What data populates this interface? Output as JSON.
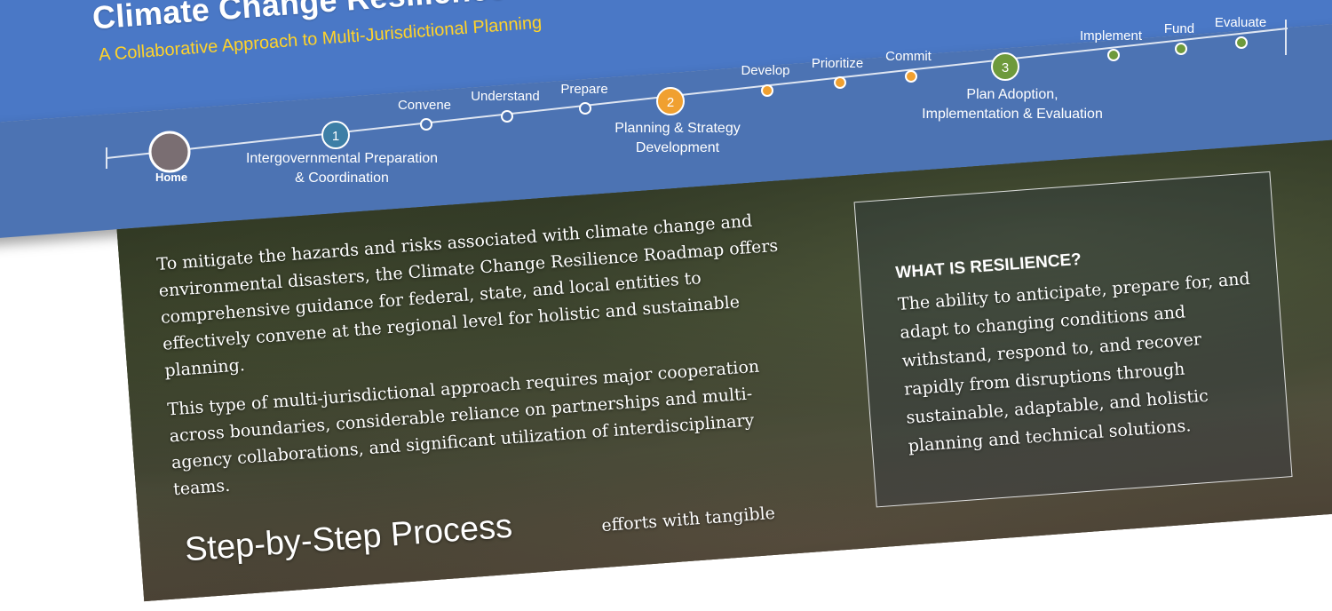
{
  "header": {
    "title": "Climate Change Resilience Roadmap",
    "subtitle": "A Collaborative Approach to Multi-Jurisdictional Planning"
  },
  "nav": {
    "home": "Home",
    "phases": [
      {
        "number": "1",
        "line1": "Intergovernmental Preparation",
        "line2": "& Coordination"
      },
      {
        "number": "2",
        "line1": "Planning & Strategy",
        "line2": "Development"
      },
      {
        "number": "3",
        "line1": "Plan Adoption,",
        "line2": "Implementation & Evaluation"
      }
    ],
    "steps": [
      "Convene",
      "Understand",
      "Prepare",
      "Develop",
      "Prioritize",
      "Commit",
      "Implement",
      "Fund",
      "Evaluate"
    ]
  },
  "hero": {
    "paragraph1": "To mitigate the hazards and risks associated with climate change and environmental disasters, the Climate Change Resilience Roadmap offers comprehensive guidance for federal, state, and local entities to effectively convene at the regional level for holistic and sustainable planning.",
    "paragraph2": "This type of multi-jurisdictional approach requires major cooperation across boundaries, considerable reliance on partnerships and multi-agency collaborations, and significant utilization of interdisciplinary teams."
  },
  "resilience": {
    "title": "WHAT IS RESILIENCE?",
    "body": "The ability to anticipate, prepare for, and adapt to changing conditions and withstand, respond to, and recover rapidly from disruptions through sustainable, adaptable, and holistic planning and technical solutions."
  },
  "process": {
    "heading": "Step-by-Step Process",
    "partial_text": "efforts with tangible"
  },
  "colors": {
    "header_blue": "#4a78c6",
    "nav_blue": "#4c73b3",
    "subtitle_yellow": "#ffd32a",
    "phase1_teal": "#3d7fa6",
    "phase2_orange": "#f0a030",
    "phase3_green": "#6e9a3c",
    "home_gray": "#7a6e72"
  }
}
